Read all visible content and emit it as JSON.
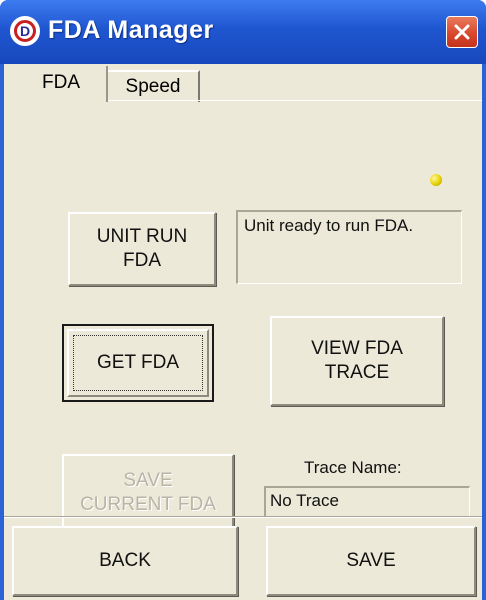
{
  "window": {
    "title": "FDA Manager",
    "app_icon_letter": "D"
  },
  "tabs": [
    {
      "label": "FDA",
      "active": true
    },
    {
      "label": "Speed",
      "active": false
    }
  ],
  "status": {
    "indicator_color": "#e8d100",
    "message": "Unit ready to run FDA."
  },
  "buttons": {
    "unit_run": "UNIT RUN\nFDA",
    "get_fda": "GET FDA",
    "view_trace": "VIEW FDA\nTRACE",
    "save_current": "SAVE\nCURRENT FDA",
    "back": "BACK",
    "save": "SAVE"
  },
  "trace": {
    "label": "Trace Name:",
    "value": "No Trace"
  },
  "colors": {
    "title_bar": "#1f56d0",
    "close_button": "#d7452a",
    "dialog_face": "#ece9d8"
  }
}
